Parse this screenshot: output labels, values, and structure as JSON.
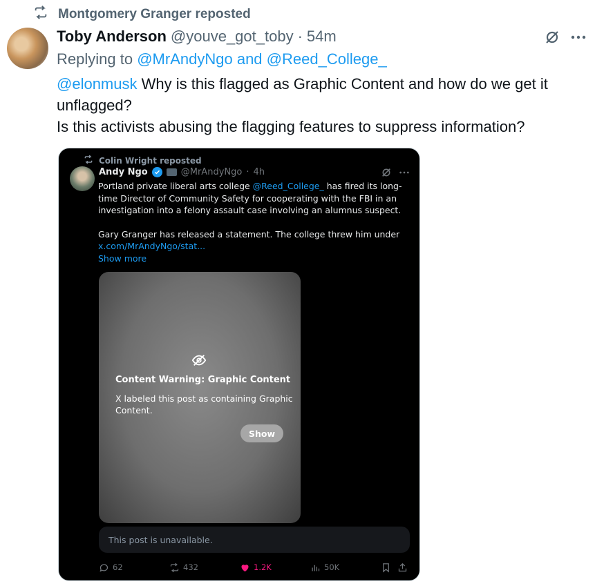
{
  "repost_banner": {
    "text": "Montgomery Granger reposted",
    "icon": "repost-icon"
  },
  "author": {
    "name": "Toby Anderson",
    "handle": "@youve_got_toby",
    "separator": "·",
    "time": "54m"
  },
  "reply": {
    "prefix": "Replying to",
    "mention1": "@MrAndyNgo",
    "joiner": "and",
    "mention2": "@Reed_College_"
  },
  "tweet": {
    "mention": "@elonmusk",
    "line1": " Why is this flagged as Graphic Content and how do we get it unflagged?",
    "line2": "Is this activists abusing the flagging features to suppress information?"
  },
  "quoted": {
    "repost_text": "Colin Wright reposted",
    "author_name": "Andy Ngo",
    "author_handle": "@MrAndyNgo",
    "separator": "·",
    "time": "4h",
    "body_pre": "Portland private liberal arts college ",
    "body_mention": "@Reed_College_",
    "body_post": " has fired its long-time Director of Community Safety for cooperating with the FBI in an investigation into a felony assault case involving an alumnus suspect.",
    "body2": "Gary Granger has released a statement. The college threw him under",
    "link": "x.com/MrAndyNgo/stat...",
    "show_more": "Show more",
    "warning_title": "Content Warning: Graphic Content",
    "warning_desc": "X labeled this post as containing Graphic Content.",
    "show_button": "Show",
    "unavailable": "This post is unavailable.",
    "stats": {
      "replies": "62",
      "reposts": "432",
      "likes": "1.2K",
      "views": "50K"
    }
  },
  "colors": {
    "link": "#1d9bf0",
    "like": "#f91880",
    "muted": "#536471",
    "card_bg": "#000000"
  }
}
